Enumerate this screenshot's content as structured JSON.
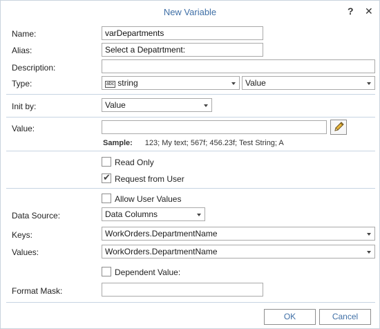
{
  "dialog": {
    "title": "New Variable",
    "help_glyph": "?",
    "close_glyph": "✕"
  },
  "form": {
    "name": {
      "label": "Name:",
      "value": "varDepartments"
    },
    "alias": {
      "label": "Alias:",
      "value": "Select a Depatrtment:"
    },
    "description": {
      "label": "Description:",
      "value": ""
    },
    "type": {
      "label": "Type:",
      "type_icon_text": "abc",
      "type_value": "string",
      "mode_value": "Value"
    },
    "init_by": {
      "label": "Init by:",
      "value": "Value"
    },
    "value": {
      "label": "Value:",
      "value": "",
      "sample_label": "Sample:",
      "sample_text": "123; My text; 567f; 456.23f; Test String; A"
    },
    "read_only": {
      "label": "Read Only",
      "checked": false
    },
    "request_from_user": {
      "label": "Request from User",
      "checked": true,
      "tick": "✔"
    },
    "allow_user_values": {
      "label": "Allow User Values",
      "checked": false
    },
    "data_source": {
      "label": "Data Source:",
      "value": "Data Columns"
    },
    "keys": {
      "label": "Keys:",
      "value": "WorkOrders.DepartmentName"
    },
    "values": {
      "label": "Values:",
      "value": "WorkOrders.DepartmentName"
    },
    "dependent_value": {
      "label": "Dependent Value:",
      "checked": false
    },
    "format_mask": {
      "label": "Format Mask:",
      "value": ""
    }
  },
  "buttons": {
    "ok": "OK",
    "cancel": "Cancel"
  },
  "colors": {
    "title": "#3f6fa6",
    "separator": "#c6d4e2",
    "border": "#a9a9a9"
  }
}
